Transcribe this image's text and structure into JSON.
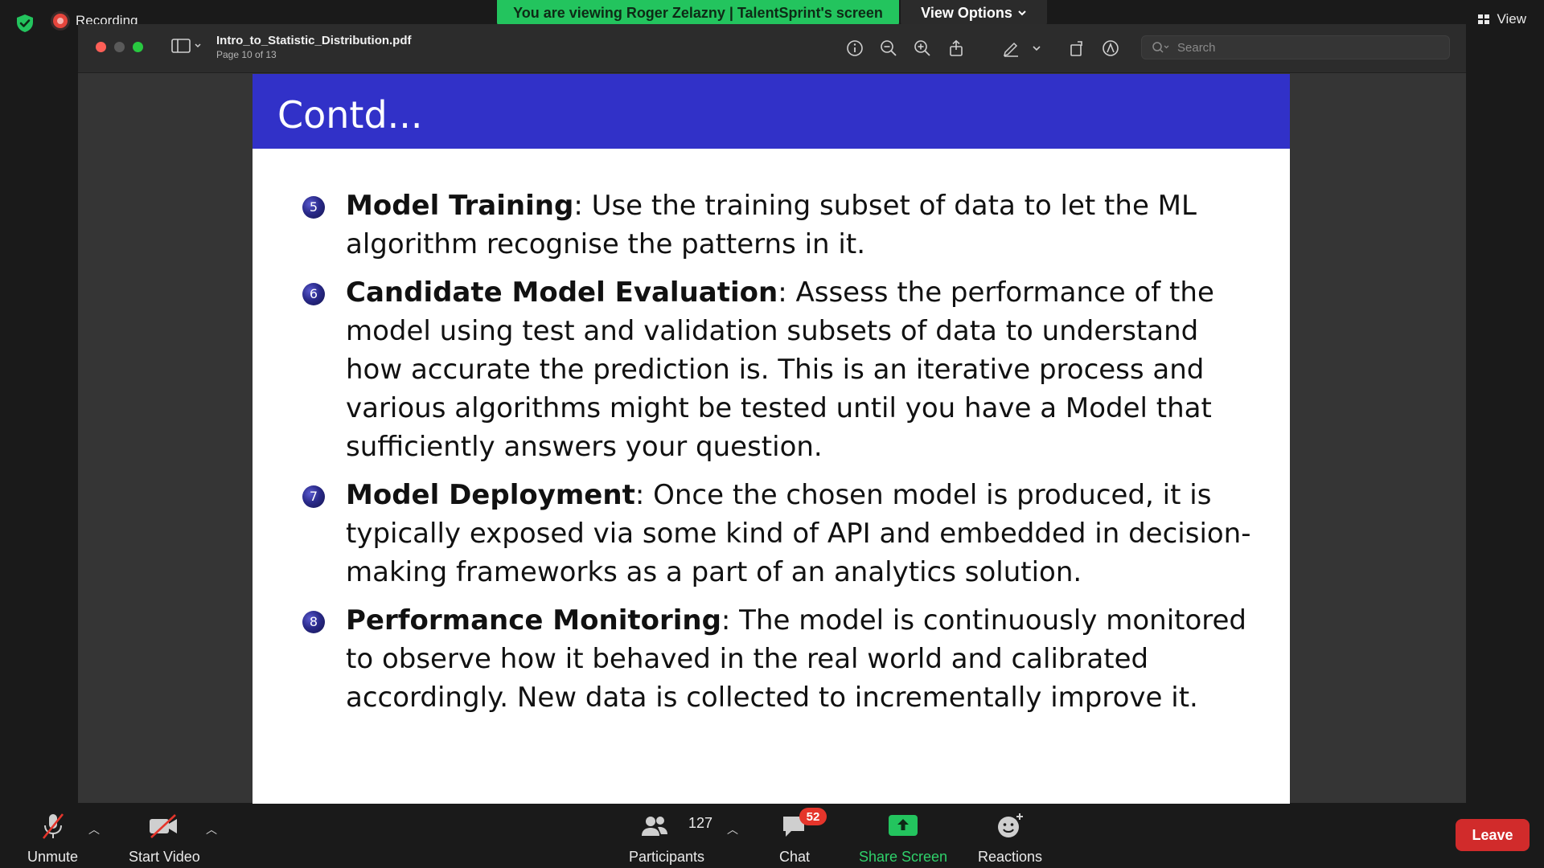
{
  "zoom": {
    "recording_label": "Recording",
    "viewing_banner": "You are viewing Roger Zelazny | TalentSprint's screen",
    "view_options_label": "View Options",
    "view_label": "View",
    "controls": {
      "unmute": "Unmute",
      "start_video": "Start Video",
      "participants": "Participants",
      "participants_count": "127",
      "chat": "Chat",
      "chat_badge": "52",
      "share_screen": "Share Screen",
      "reactions": "Reactions",
      "leave": "Leave"
    },
    "colors": {
      "share": "#23c45e",
      "leave": "#d12b2b",
      "badge": "#e5352b"
    }
  },
  "pdf": {
    "file_name": "Intro_to_Statistic_Distribution.pdf",
    "page_info": "Page 10 of 13",
    "search_placeholder": "Search",
    "toolbar_icons": [
      "info-icon",
      "zoom-out-icon",
      "zoom-in-icon",
      "share-icon",
      "highlight-pen-icon",
      "chevron-down-icon",
      "rotate-icon",
      "markup-icon"
    ]
  },
  "slide": {
    "title": "Contd...",
    "header_color": "#3131c8",
    "items": [
      {
        "number": "5",
        "heading": "Model Training",
        "text": ": Use the training subset of data to let the ML algorithm recognise the patterns in it."
      },
      {
        "number": "6",
        "heading": "Candidate Model Evaluation",
        "text": ": Assess the performance of the model using test and validation subsets of data to understand how accurate the prediction is. This is an iterative process and various algorithms might be tested until you have a Model that sufficiently answers your question."
      },
      {
        "number": "7",
        "heading": "Model Deployment",
        "text": ": Once the chosen model is produced, it is typically exposed via some kind of API and embedded in decision-making frameworks as a part of an analytics solution."
      },
      {
        "number": "8",
        "heading": "Performance Monitoring",
        "text": ": The model is continuously monitored to observe how it behaved in the real world and calibrated accordingly. New data is collected to incrementally improve it."
      }
    ]
  }
}
